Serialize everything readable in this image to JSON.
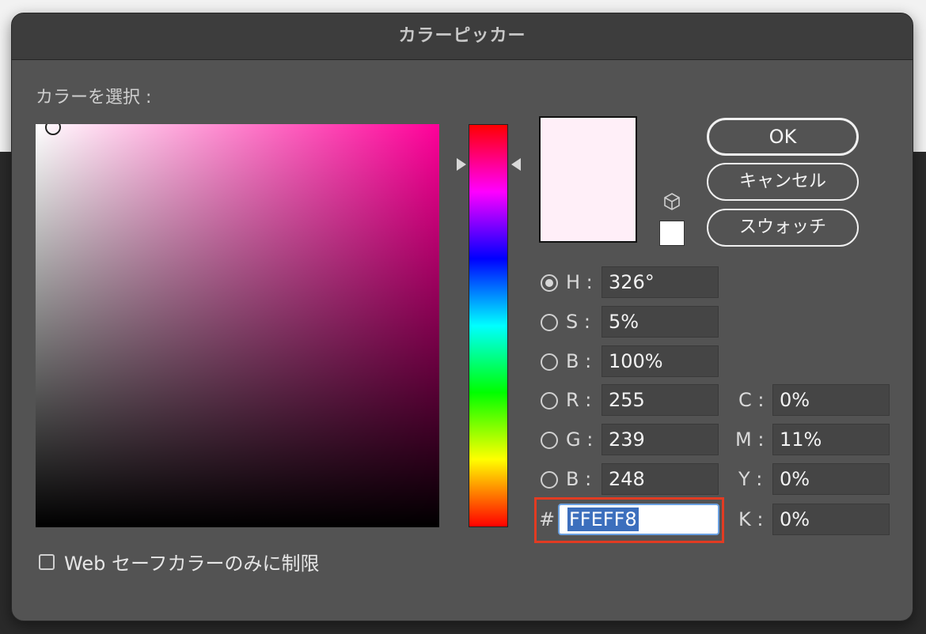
{
  "dialog": {
    "title": "カラーピッカー",
    "select_label": "カラーを選択 :"
  },
  "buttons": {
    "ok": "OK",
    "cancel": "キャンセル",
    "swatches": "スウォッチ"
  },
  "hsb": {
    "h_label": "H :",
    "h_value": "326°",
    "s_label": "S :",
    "s_value": "5%",
    "b_label": "B :",
    "b_value": "100%",
    "selected": "H"
  },
  "rgb": {
    "r_label": "R :",
    "r_value": "255",
    "g_label": "G :",
    "g_value": "239",
    "b_label": "B :",
    "b_value": "248"
  },
  "cmyk": {
    "c_label": "C :",
    "c_value": "0%",
    "m_label": "M :",
    "m_value": "11%",
    "y_label": "Y :",
    "y_value": "0%",
    "k_label": "K :",
    "k_value": "0%"
  },
  "hex": {
    "label": "#",
    "value": "FFEFF8"
  },
  "web_safe": {
    "label": "Web セーフカラーのみに制限",
    "checked": false
  },
  "colors": {
    "current_color": "#ffeff8",
    "hue_color": "#ff0099",
    "web_safe_color": "#ffffff",
    "highlight_border": "#e23b22"
  },
  "icons": {
    "gamut_warning": "cube-icon",
    "hue_pointer_left": "triangle-right-icon",
    "hue_pointer_right": "triangle-left-icon"
  }
}
